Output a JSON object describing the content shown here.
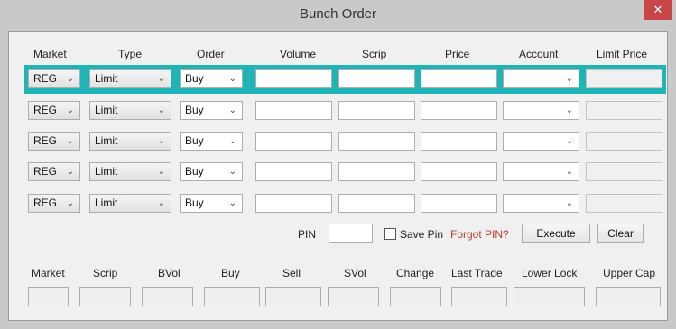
{
  "window": {
    "title": "Bunch Order",
    "close_symbol": "✕"
  },
  "order_headers": [
    "Market",
    "Type",
    "Order",
    "Volume",
    "Scrip",
    "Price",
    "Account",
    "Limit Price"
  ],
  "rows": [
    {
      "market": "REG",
      "type": "Limit",
      "order": "Buy"
    },
    {
      "market": "REG",
      "type": "Limit",
      "order": "Buy"
    },
    {
      "market": "REG",
      "type": "Limit",
      "order": "Buy"
    },
    {
      "market": "REG",
      "type": "Limit",
      "order": "Buy"
    },
    {
      "market": "REG",
      "type": "Limit",
      "order": "Buy"
    }
  ],
  "pin": {
    "label": "PIN",
    "value": "",
    "save_pin_label": "Save Pin",
    "save_pin_checked": false,
    "forgot_label": "Forgot PIN?"
  },
  "buttons": {
    "execute": "Execute",
    "clear": "Clear"
  },
  "quote_headers": [
    "Market",
    "Scrip",
    "BVol",
    "Buy",
    "Sell",
    "SVol",
    "Change",
    "Last Trade",
    "Lower Lock",
    "Upper Cap"
  ],
  "icons": {
    "dropdown": "chevron-down-icon",
    "close": "close-icon"
  },
  "colors": {
    "selected_row": "#1fb5b7",
    "close_button": "#c8454a",
    "forgot_link": "#c0392b"
  }
}
